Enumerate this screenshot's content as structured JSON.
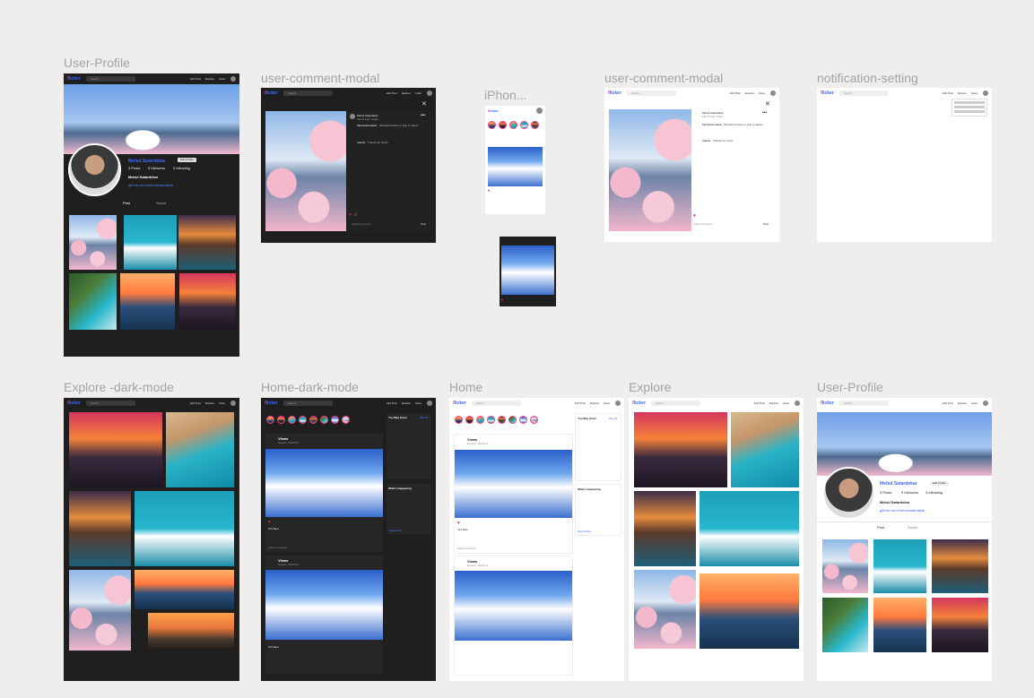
{
  "frames": {
    "user_profile_dark": "User-Profile",
    "user_comment_modal_dark": "user-comment-modal",
    "iphone": "iPhon...",
    "user_comment_modal_light": "user-comment-modal",
    "notification_setting": "notification-setting",
    "explore_dark": "Explore -dark-mode",
    "home_dark": "Home-dark-mode",
    "home": "Home",
    "explore": "Explore",
    "user_profile_light": "User-Profile"
  },
  "app": {
    "logo_prefix": "f",
    "logo_rest": "licker",
    "search_placeholder": "Search",
    "nav_items": [
      "Add Post",
      "Explore",
      "Likes"
    ]
  },
  "profile": {
    "name": "Mehul Satardekar",
    "edit_label": "Edit Profile",
    "posts": "3 Posts",
    "followers": "5 followers",
    "following": "3 following",
    "display_name": "Mehul Satardekar",
    "link": "github.com/mehulsatardekar",
    "tab_post": "Post",
    "tab_saved": "Saved"
  },
  "post": {
    "user": "Views",
    "location": "Greece, Santorini",
    "likes": "212 likes",
    "likes_second": "212 likes",
    "comment_placeholder": "Add a comment...",
    "post_label": "Post"
  },
  "sidebar": {
    "suggestions_title": "You May know",
    "see_all": "See All",
    "happening_title": "What's happening",
    "show_more": "Show More"
  },
  "comment_modal": {
    "caption_user": "Mehul Satardekar",
    "caption_location": "Mount Fuji, Japan",
    "comment_user": "Mehulsatardekar",
    "comment_text": "Wonderful place to stay in Japan",
    "reply_user": "Aastha",
    "reply_text": "Thanks for views"
  },
  "colors": {
    "canvas": "#efeeec",
    "dark_panel": "#1f1f1f",
    "accent_blue": "#3b6bff",
    "accent_pink": "#ff2d8a",
    "like_red": "#e0245e"
  }
}
